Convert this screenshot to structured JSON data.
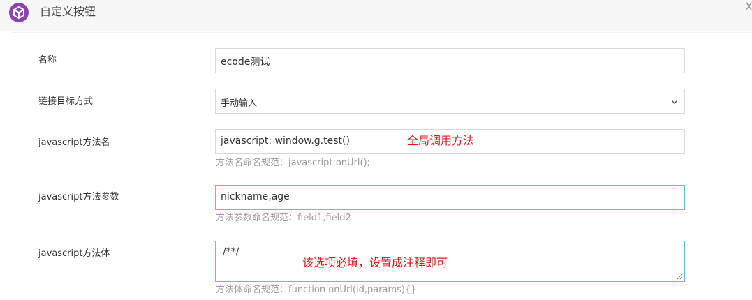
{
  "dialog": {
    "title": "自定义按钮",
    "icon": "cube-icon",
    "close_label": "X"
  },
  "form": {
    "name": {
      "label": "名称",
      "value": "ecode测试"
    },
    "link_mode": {
      "label": "链接目标方式",
      "selected": "手动输入"
    },
    "js_method_name": {
      "label": "javascript方法名",
      "value": "javascript: window.g.test()",
      "help": "方法名命名规范：javascript:onUrl();",
      "annotation": "全局调用方法"
    },
    "js_method_params": {
      "label": "javascript方法参数",
      "value": "nickname,age",
      "help": "方法参数命名规范：field1,field2"
    },
    "js_method_body": {
      "label": "javascript方法体",
      "value": "/**/",
      "help": "方法体命名规范：function onUrl(id,params){}",
      "annotation": "该选项必填，设置成注释即可"
    }
  },
  "colors": {
    "icon_purple": "#8e44ad",
    "active_border": "#57c5d8",
    "annotation_red": "#e8141a",
    "help_gray": "#999999"
  }
}
